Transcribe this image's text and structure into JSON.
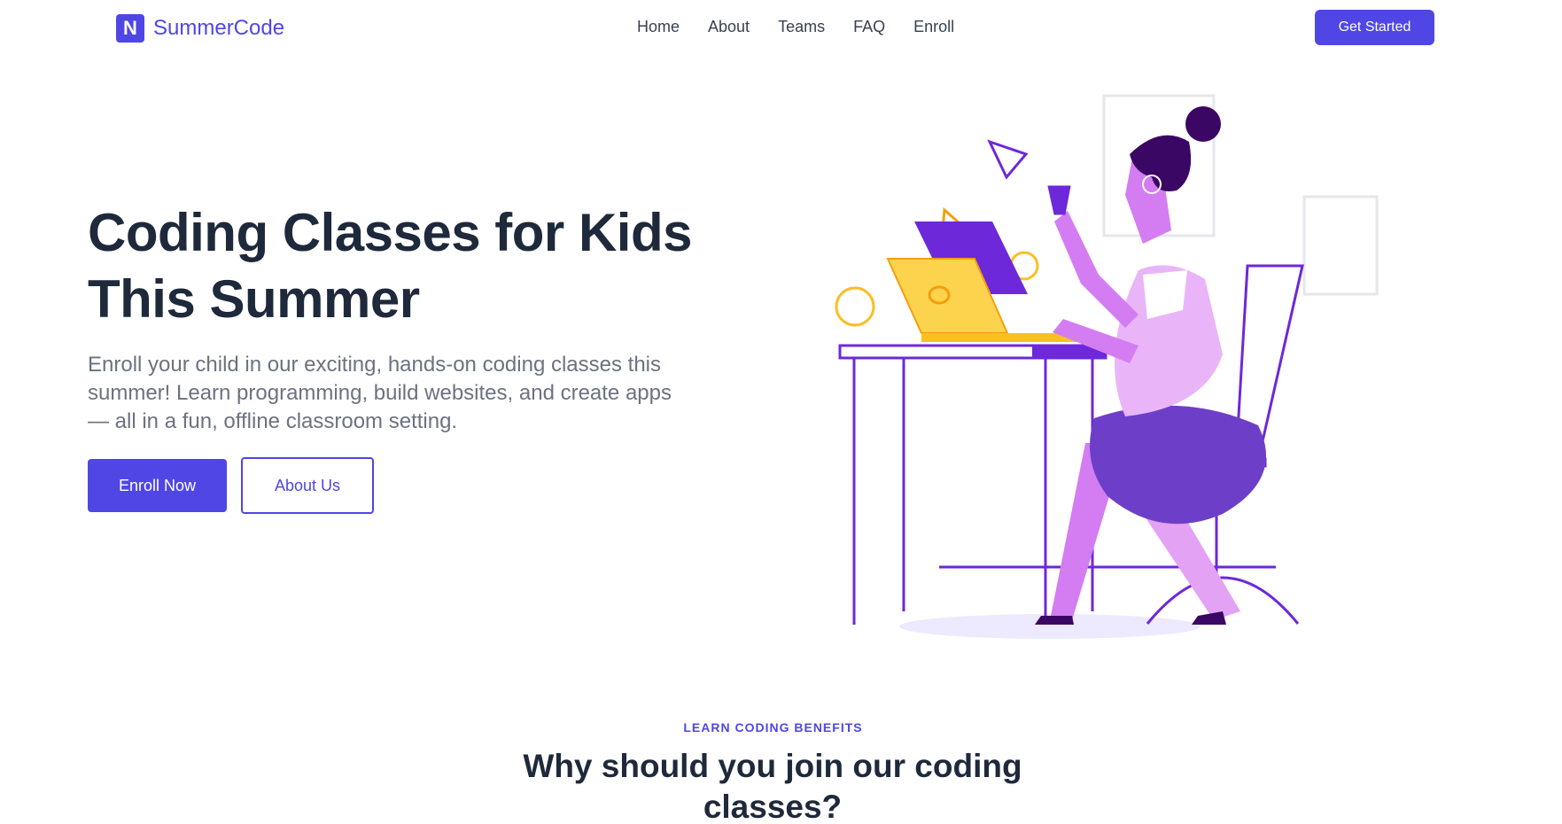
{
  "brand": {
    "mark": "N",
    "name": "SummerCode"
  },
  "nav": {
    "items": [
      "Home",
      "About",
      "Teams",
      "FAQ",
      "Enroll"
    ],
    "cta": "Get Started"
  },
  "hero": {
    "title_line1": "Coding Classes for Kids",
    "title_line2": "This Summer",
    "subtitle": "Enroll your child in our exciting, hands-on coding classes this summer! Learn programming, build websites, and create apps — all in a fun, offline classroom setting.",
    "primary_button": "Enroll Now",
    "secondary_button": "About Us"
  },
  "benefits": {
    "eyebrow": "LEARN CODING BENEFITS",
    "title": "Why should you join our coding classes?"
  },
  "colors": {
    "accent": "#4f46e5",
    "heading": "#1e293b",
    "body": "#6b7280",
    "violet": "#d47df2",
    "yellow": "#fbbf24"
  },
  "icons": {
    "logo": "n-logo-icon",
    "illustration": "woman-at-laptop-illustration"
  }
}
